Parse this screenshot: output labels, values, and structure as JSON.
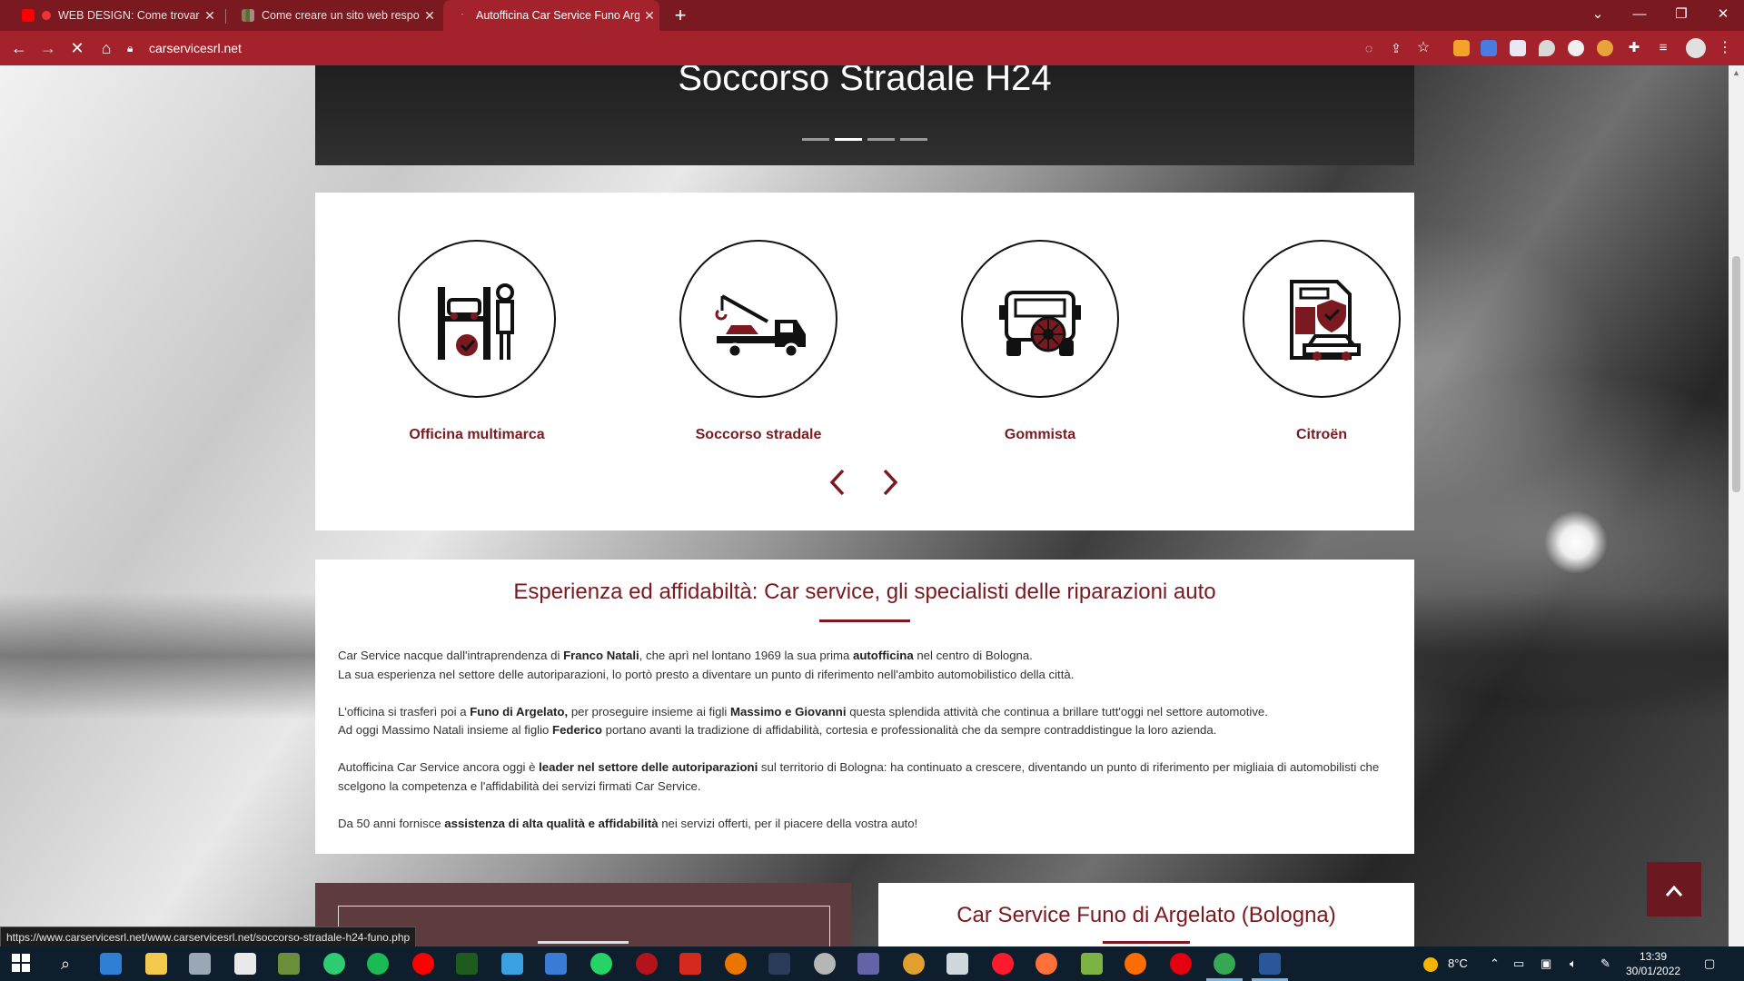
{
  "browser": {
    "tabs": [
      {
        "title": "WEB DESIGN: Come trovare i",
        "active": false
      },
      {
        "title": "Come creare un sito web respon",
        "active": false
      },
      {
        "title": "Autofficina Car Service Funo Argel",
        "active": true
      }
    ],
    "url": "carservicesrl.net",
    "status_link": "https://www.carservicesrl.net/www.carservicesrl.net/soccorso-stradale-h24-funo.php"
  },
  "hero": {
    "title": "Soccorso Stradale H24",
    "slides": 4,
    "active_slide": 2
  },
  "services": {
    "items": [
      {
        "label": "Officina multimarca",
        "icon": "car-lift-mechanic-icon"
      },
      {
        "label": "Soccorso stradale",
        "icon": "tow-truck-icon"
      },
      {
        "label": "Gommista",
        "icon": "tire-service-icon"
      },
      {
        "label": "Citroën",
        "icon": "car-document-insurance-icon"
      }
    ],
    "prev": "‹",
    "next": "›"
  },
  "about": {
    "title": "Esperienza ed affidabiltà: Car service, gli specialisti delle riparazioni auto"
  },
  "contact": {
    "title": "Car Service Funo di Argelato (Bologna)"
  },
  "back_to_top": "⌃",
  "taskbar": {
    "weather": "8°C",
    "time": "13:39",
    "date": "30/01/2022"
  },
  "colors": {
    "brand": "#7a1a20",
    "chrome_frame": "#7a1a20",
    "chrome_toolbar": "#a3222b"
  }
}
